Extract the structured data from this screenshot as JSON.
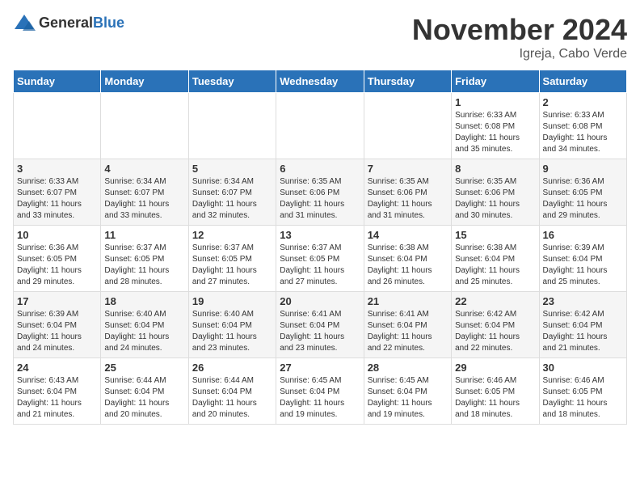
{
  "logo": {
    "general": "General",
    "blue": "Blue"
  },
  "title": {
    "month": "November 2024",
    "location": "Igreja, Cabo Verde"
  },
  "headers": [
    "Sunday",
    "Monday",
    "Tuesday",
    "Wednesday",
    "Thursday",
    "Friday",
    "Saturday"
  ],
  "weeks": [
    [
      {
        "day": "",
        "info": ""
      },
      {
        "day": "",
        "info": ""
      },
      {
        "day": "",
        "info": ""
      },
      {
        "day": "",
        "info": ""
      },
      {
        "day": "",
        "info": ""
      },
      {
        "day": "1",
        "info": "Sunrise: 6:33 AM\nSunset: 6:08 PM\nDaylight: 11 hours\nand 35 minutes."
      },
      {
        "day": "2",
        "info": "Sunrise: 6:33 AM\nSunset: 6:08 PM\nDaylight: 11 hours\nand 34 minutes."
      }
    ],
    [
      {
        "day": "3",
        "info": "Sunrise: 6:33 AM\nSunset: 6:07 PM\nDaylight: 11 hours\nand 33 minutes."
      },
      {
        "day": "4",
        "info": "Sunrise: 6:34 AM\nSunset: 6:07 PM\nDaylight: 11 hours\nand 33 minutes."
      },
      {
        "day": "5",
        "info": "Sunrise: 6:34 AM\nSunset: 6:07 PM\nDaylight: 11 hours\nand 32 minutes."
      },
      {
        "day": "6",
        "info": "Sunrise: 6:35 AM\nSunset: 6:06 PM\nDaylight: 11 hours\nand 31 minutes."
      },
      {
        "day": "7",
        "info": "Sunrise: 6:35 AM\nSunset: 6:06 PM\nDaylight: 11 hours\nand 31 minutes."
      },
      {
        "day": "8",
        "info": "Sunrise: 6:35 AM\nSunset: 6:06 PM\nDaylight: 11 hours\nand 30 minutes."
      },
      {
        "day": "9",
        "info": "Sunrise: 6:36 AM\nSunset: 6:05 PM\nDaylight: 11 hours\nand 29 minutes."
      }
    ],
    [
      {
        "day": "10",
        "info": "Sunrise: 6:36 AM\nSunset: 6:05 PM\nDaylight: 11 hours\nand 29 minutes."
      },
      {
        "day": "11",
        "info": "Sunrise: 6:37 AM\nSunset: 6:05 PM\nDaylight: 11 hours\nand 28 minutes."
      },
      {
        "day": "12",
        "info": "Sunrise: 6:37 AM\nSunset: 6:05 PM\nDaylight: 11 hours\nand 27 minutes."
      },
      {
        "day": "13",
        "info": "Sunrise: 6:37 AM\nSunset: 6:05 PM\nDaylight: 11 hours\nand 27 minutes."
      },
      {
        "day": "14",
        "info": "Sunrise: 6:38 AM\nSunset: 6:04 PM\nDaylight: 11 hours\nand 26 minutes."
      },
      {
        "day": "15",
        "info": "Sunrise: 6:38 AM\nSunset: 6:04 PM\nDaylight: 11 hours\nand 25 minutes."
      },
      {
        "day": "16",
        "info": "Sunrise: 6:39 AM\nSunset: 6:04 PM\nDaylight: 11 hours\nand 25 minutes."
      }
    ],
    [
      {
        "day": "17",
        "info": "Sunrise: 6:39 AM\nSunset: 6:04 PM\nDaylight: 11 hours\nand 24 minutes."
      },
      {
        "day": "18",
        "info": "Sunrise: 6:40 AM\nSunset: 6:04 PM\nDaylight: 11 hours\nand 24 minutes."
      },
      {
        "day": "19",
        "info": "Sunrise: 6:40 AM\nSunset: 6:04 PM\nDaylight: 11 hours\nand 23 minutes."
      },
      {
        "day": "20",
        "info": "Sunrise: 6:41 AM\nSunset: 6:04 PM\nDaylight: 11 hours\nand 23 minutes."
      },
      {
        "day": "21",
        "info": "Sunrise: 6:41 AM\nSunset: 6:04 PM\nDaylight: 11 hours\nand 22 minutes."
      },
      {
        "day": "22",
        "info": "Sunrise: 6:42 AM\nSunset: 6:04 PM\nDaylight: 11 hours\nand 22 minutes."
      },
      {
        "day": "23",
        "info": "Sunrise: 6:42 AM\nSunset: 6:04 PM\nDaylight: 11 hours\nand 21 minutes."
      }
    ],
    [
      {
        "day": "24",
        "info": "Sunrise: 6:43 AM\nSunset: 6:04 PM\nDaylight: 11 hours\nand 21 minutes."
      },
      {
        "day": "25",
        "info": "Sunrise: 6:44 AM\nSunset: 6:04 PM\nDaylight: 11 hours\nand 20 minutes."
      },
      {
        "day": "26",
        "info": "Sunrise: 6:44 AM\nSunset: 6:04 PM\nDaylight: 11 hours\nand 20 minutes."
      },
      {
        "day": "27",
        "info": "Sunrise: 6:45 AM\nSunset: 6:04 PM\nDaylight: 11 hours\nand 19 minutes."
      },
      {
        "day": "28",
        "info": "Sunrise: 6:45 AM\nSunset: 6:04 PM\nDaylight: 11 hours\nand 19 minutes."
      },
      {
        "day": "29",
        "info": "Sunrise: 6:46 AM\nSunset: 6:05 PM\nDaylight: 11 hours\nand 18 minutes."
      },
      {
        "day": "30",
        "info": "Sunrise: 6:46 AM\nSunset: 6:05 PM\nDaylight: 11 hours\nand 18 minutes."
      }
    ]
  ]
}
